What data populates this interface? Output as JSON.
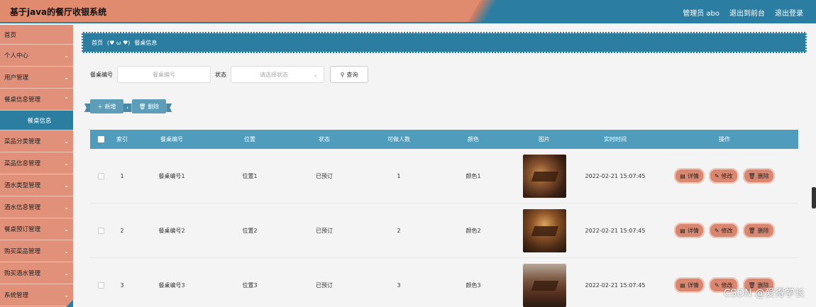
{
  "header": {
    "title": "基于java的餐厅收银系统",
    "admin": "管理员 abo",
    "back_to_front": "退出到前台",
    "logout": "退出登录"
  },
  "sidebar": {
    "items": [
      {
        "label": "首页",
        "chevron": false
      },
      {
        "label": "个人中心",
        "chevron": true
      },
      {
        "label": "用户管理",
        "chevron": true
      },
      {
        "label": "餐桌信息管理",
        "chevron": true
      },
      {
        "label": "餐桌信息",
        "chevron": false,
        "sub": true
      },
      {
        "label": "菜品分类管理",
        "chevron": true
      },
      {
        "label": "菜品信息管理",
        "chevron": true
      },
      {
        "label": "酒水类型管理",
        "chevron": true
      },
      {
        "label": "酒水信息管理",
        "chevron": true
      },
      {
        "label": "餐桌预订管理",
        "chevron": true
      },
      {
        "label": "购买菜品管理",
        "chevron": true
      },
      {
        "label": "购买酒水管理",
        "chevron": true
      },
      {
        "label": "系统管理",
        "chevron": true
      }
    ]
  },
  "breadcrumb": {
    "home": "首页",
    "separator": "(♥ ω ♥)",
    "current": "餐桌信息"
  },
  "search": {
    "table_no_label": "餐桌编号",
    "table_no_placeholder": "餐桌编号",
    "status_label": "状态",
    "status_placeholder": "请选择状态",
    "query_button": "查询"
  },
  "actions": {
    "add": "新增",
    "delete": "删除"
  },
  "table": {
    "headers": [
      "索引",
      "餐桌编号",
      "位置",
      "状态",
      "可做人数",
      "颜色",
      "图片",
      "实时时间",
      "操作"
    ],
    "rows": [
      {
        "index": "1",
        "table_no": "餐桌编号1",
        "location": "位置1",
        "status": "已预订",
        "capacity": "1",
        "color": "颜色1",
        "time": "2022-02-21 15:07:45"
      },
      {
        "index": "2",
        "table_no": "餐桌编号2",
        "location": "位置2",
        "status": "已预订",
        "capacity": "2",
        "color": "颜色2",
        "time": "2022-02-21 15:07:45"
      },
      {
        "index": "3",
        "table_no": "餐桌编号3",
        "location": "位置3",
        "status": "已预订",
        "capacity": "3",
        "color": "颜色3",
        "time": "2022-02-21 15:07:45"
      }
    ],
    "op_detail": "详情",
    "op_edit": "修改",
    "op_delete": "删除"
  },
  "watermark": "CSDN @爱得学长",
  "colors": {
    "accent_blue": "#2c7ea0",
    "accent_salmon": "#e1917a",
    "header_blue": "#4f9cbc"
  }
}
